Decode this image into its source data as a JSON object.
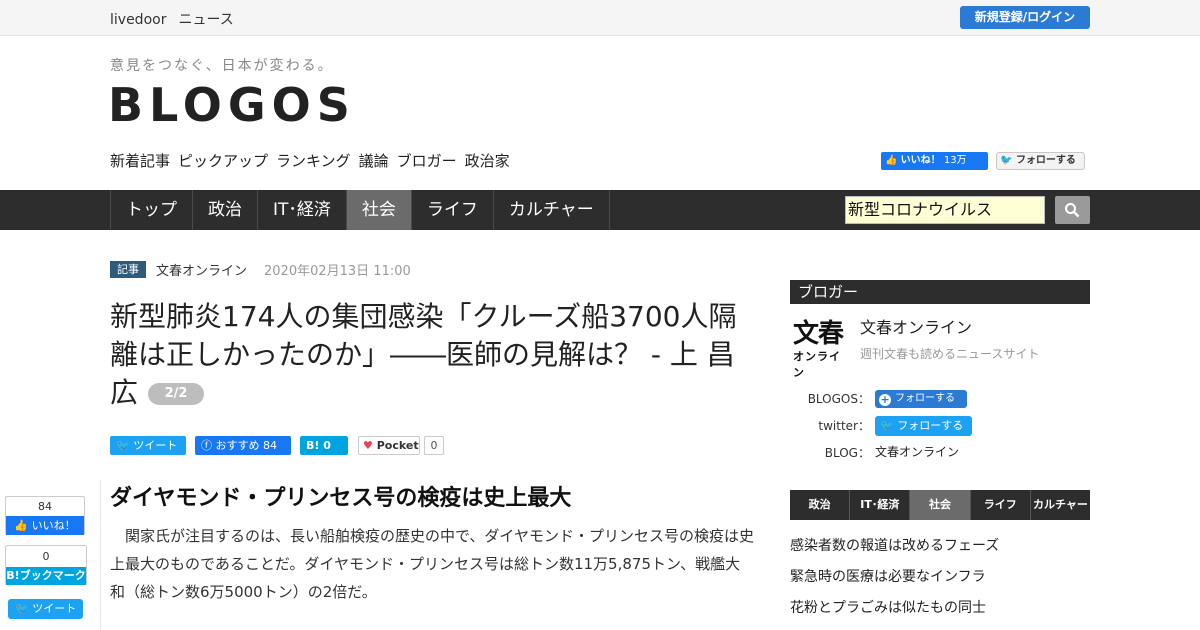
{
  "topbar": {
    "brand1": "livedoor",
    "brand2": "ニュース",
    "login_label": "新規登録/ログイン"
  },
  "header": {
    "tagline": "意見をつなぐ、日本が変わる。",
    "logo": "BLOGOS",
    "subnav": [
      "新着記事",
      "ピックアップ",
      "ランキング",
      "議論",
      "ブロガー",
      "政治家"
    ],
    "fb_like_label": "いいね！",
    "fb_like_count": "13万",
    "twitter_follow_label": "フォローする"
  },
  "mainnav": {
    "tabs": [
      "トップ",
      "政治",
      "IT･経済",
      "社会",
      "ライフ",
      "カルチャー"
    ],
    "active_tab": "社会",
    "search_value": "新型コロナウイルス"
  },
  "article": {
    "badge": "記事",
    "source": "文春オンライン",
    "date": "2020年02月13日 11:00",
    "title": "新型肺炎174人の集団感染「クルーズ船3700人隔離は正しかったのか」――医師の見解は？ - 上 昌広",
    "page_indicator": "2/2",
    "share": {
      "tweet": "ツイート",
      "fb_recommend": "おすすめ",
      "fb_count": "84",
      "hatena_label": "B!",
      "hatena_count": "0",
      "pocket_label": "Pocket",
      "pocket_count": "0"
    },
    "heading": "ダイヤモンド・プリンセス号の検疫は史上最大",
    "body": "関家氏が注目するのは、長い船舶検疫の歴史の中で、ダイヤモンド・プリンセス号の検疫は史上最大のものであることだ。ダイヤモンド・プリンセス号は総トン数11万5,875トン、戦艦大和（総トン数6万5000トン）の2倍だ。"
  },
  "floating": {
    "fb_count": "84",
    "fb_label": "いいね！",
    "hatena_count": "0",
    "hatena_label": "B!ブックマーク",
    "tweet_label": "ツイート"
  },
  "sidebar": {
    "head": "ブロガー",
    "logo_big": "文春",
    "logo_small": "オンライン",
    "name": "文春オンライン",
    "desc": "週刊文春も読めるニュースサイト",
    "blogos_label": "BLOGOS：",
    "blogos_follow": "フォローする",
    "twitter_label": "twitter：",
    "twitter_follow": "フォローする",
    "blog_label": "BLOG：",
    "blog_value": "文春オンライン",
    "cat_tabs": [
      "政治",
      "IT･経済",
      "社会",
      "ライフ",
      "カルチャー"
    ],
    "cat_active": "社会",
    "news": [
      "感染者数の報道は改めるフェーズ",
      "緊急時の医療は必要なインフラ",
      "花粉とプラごみは似たもの同士"
    ]
  },
  "colors": {
    "accent_blue": "#2b7bd4",
    "nav_dark": "#2d2d2d",
    "nav_active": "#6b6b6b",
    "twitter": "#1da1f2",
    "facebook": "#1877f2",
    "hatena": "#00a4de"
  }
}
